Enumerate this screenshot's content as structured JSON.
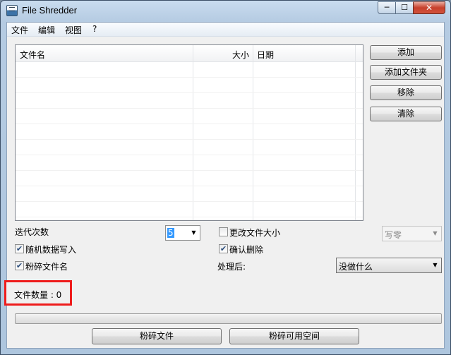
{
  "window": {
    "title": "File Shredder",
    "close_glyph": "✕",
    "minimize_glyph": "─",
    "maximize_glyph": "☐"
  },
  "menu": {
    "items": [
      "文件",
      "编辑",
      "视图",
      "?"
    ]
  },
  "file_list": {
    "columns": [
      "文件名",
      "大小",
      "日期"
    ],
    "rows": []
  },
  "side_buttons": {
    "add": "添加",
    "add_folder": "添加文件夹",
    "remove": "移除",
    "clear": "清除"
  },
  "options": {
    "iterations_label": "迭代次数",
    "iterations_value": "5",
    "change_size_label": "更改文件大小",
    "change_size_checked": false,
    "write_mode_value": "写零",
    "random_data_label": "随机数据写入",
    "random_data_checked": true,
    "confirm_delete_label": "确认删除",
    "confirm_delete_checked": true,
    "shred_names_label": "粉碎文件名",
    "shred_names_checked": true,
    "after_label": "处理后:",
    "after_value": "没做什么"
  },
  "status": {
    "file_count_text": "文件数量 : 0"
  },
  "progress": {
    "fraction": 0
  },
  "actions": {
    "shred_files": "粉碎文件",
    "shred_free_space": "粉碎可用空间"
  },
  "colors": {
    "highlight": "#ee1c1c",
    "selection": "#3399ff"
  }
}
